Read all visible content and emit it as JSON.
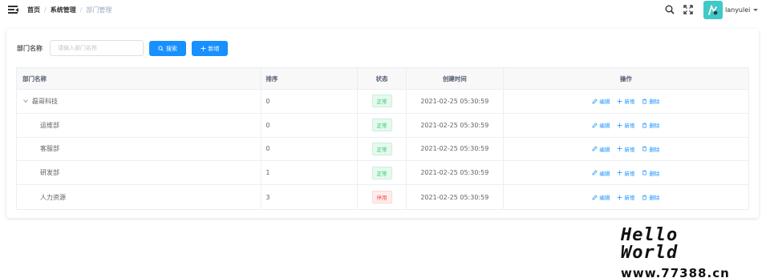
{
  "header": {
    "breadcrumb": [
      "首页",
      "系统管理",
      "部门管理"
    ],
    "separator": "/",
    "username": "lanyulei",
    "icons": [
      "hamburger-icon",
      "search-icon",
      "fullscreen-icon"
    ]
  },
  "search": {
    "label": "部门名称",
    "placeholder": "请输入部门名称",
    "search_button": "搜索",
    "add_button": "新增"
  },
  "table": {
    "columns": [
      "部门名称",
      "排序",
      "状态",
      "创建时间",
      "操作"
    ],
    "rows": [
      {
        "name": "磊哥科技",
        "sort": "0",
        "status": "正常",
        "created": "2021-02-25 05:30:59",
        "level": 0,
        "expanded": true
      },
      {
        "name": "运维部",
        "sort": "0",
        "status": "正常",
        "created": "2021-02-25 05:30:59",
        "level": 1
      },
      {
        "name": "客服部",
        "sort": "0",
        "status": "正常",
        "created": "2021-02-25 05:30:59",
        "level": 1
      },
      {
        "name": "研发部",
        "sort": "1",
        "status": "正常",
        "created": "2021-02-25 05:30:59",
        "level": 1
      },
      {
        "name": "人力资源",
        "sort": "3",
        "status": "停用",
        "created": "2021-02-25 05:30:59",
        "level": 1
      }
    ],
    "actions": {
      "edit": "编辑",
      "add": "新增",
      "delete": "删除"
    }
  },
  "watermark": {
    "title": "Hello World",
    "url": "www.77388.cn"
  },
  "colors": {
    "primary": "#1890ff",
    "success": "#13ce66",
    "danger": "#ff4949",
    "avatar_bg": "#40c9c6"
  }
}
